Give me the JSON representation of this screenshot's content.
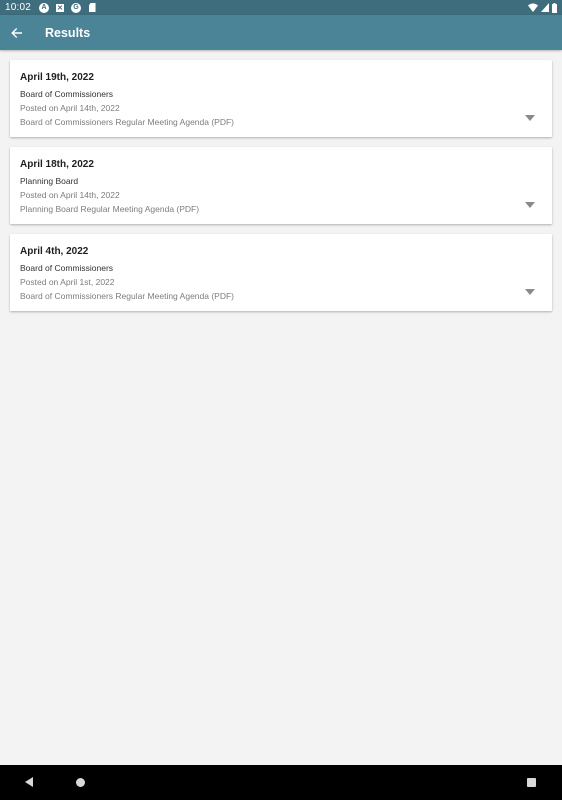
{
  "status_bar": {
    "time": "10:02",
    "icons": [
      "notification-a-icon",
      "notification-x-icon",
      "notification-g-icon",
      "sd-card-icon",
      "wifi-icon",
      "cell-signal-icon",
      "battery-icon"
    ]
  },
  "app_bar": {
    "title": "Results",
    "back_icon": "arrow-back-icon"
  },
  "results": [
    {
      "date": "April 19th, 2022",
      "board": "Board of Commissioners",
      "posted": "Posted on April 14th, 2022",
      "document": "Board of Commissioners Regular Meeting Agenda (PDF)"
    },
    {
      "date": "April 18th, 2022",
      "board": "Planning Board",
      "posted": "Posted on April 14th, 2022",
      "document": "Planning Board Regular Meeting Agenda (PDF)"
    },
    {
      "date": "April 4th, 2022",
      "board": "Board of Commissioners",
      "posted": "Posted on April 1st, 2022",
      "document": "Board of Commissioners Regular Meeting Agenda (PDF)"
    }
  ],
  "colors": {
    "status_bar": "#3e6d7e",
    "app_bar": "#4b8397",
    "background": "#f3f3f3",
    "card": "#ffffff"
  },
  "nav_bar": {
    "buttons": [
      "nav-back-icon",
      "nav-home-icon",
      "nav-recents-icon"
    ]
  }
}
